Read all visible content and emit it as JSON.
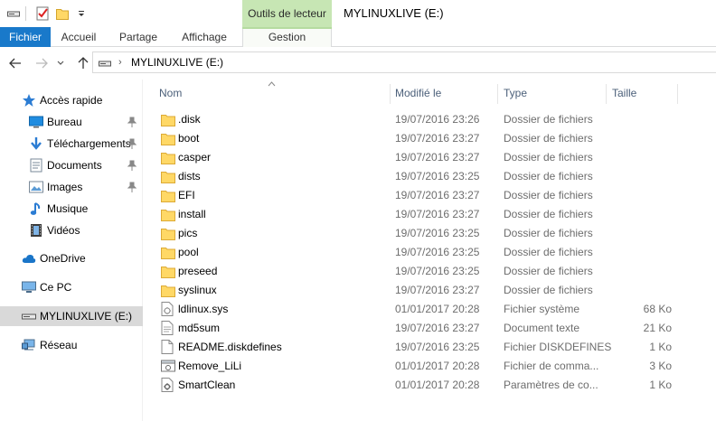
{
  "window": {
    "title": "MYLINUXLIVE (E:)"
  },
  "ribbon": {
    "context_group": "Outils de lecteur",
    "tabs": [
      {
        "label": "Fichier"
      },
      {
        "label": "Accueil"
      },
      {
        "label": "Partage"
      },
      {
        "label": "Affichage"
      },
      {
        "label": "Gestion"
      }
    ]
  },
  "address": {
    "path": "MYLINUXLIVE (E:)",
    "separator": "›"
  },
  "sidebar": {
    "items": [
      {
        "label": "Accès rapide",
        "icon": "star-icon"
      },
      {
        "label": "Bureau",
        "icon": "desktop-icon",
        "pinned": true
      },
      {
        "label": "Téléchargements",
        "icon": "download-icon",
        "pinned": true
      },
      {
        "label": "Documents",
        "icon": "documents-icon",
        "pinned": true
      },
      {
        "label": "Images",
        "icon": "images-icon",
        "pinned": true
      },
      {
        "label": "Musique",
        "icon": "music-icon"
      },
      {
        "label": "Vidéos",
        "icon": "videos-icon"
      },
      {
        "label": "OneDrive",
        "icon": "cloud-icon"
      },
      {
        "label": "Ce PC",
        "icon": "computer-icon"
      },
      {
        "label": "MYLINUXLIVE (E:)",
        "icon": "drive-icon",
        "selected": true
      },
      {
        "label": "Réseau",
        "icon": "network-icon"
      }
    ]
  },
  "columns": {
    "name": "Nom",
    "modified": "Modifié le",
    "type": "Type",
    "size": "Taille"
  },
  "files": [
    {
      "name": ".disk",
      "modified": "19/07/2016 23:26",
      "type": "Dossier de fichiers",
      "size": "",
      "icon": "folder-icon"
    },
    {
      "name": "boot",
      "modified": "19/07/2016 23:27",
      "type": "Dossier de fichiers",
      "size": "",
      "icon": "folder-icon"
    },
    {
      "name": "casper",
      "modified": "19/07/2016 23:27",
      "type": "Dossier de fichiers",
      "size": "",
      "icon": "folder-icon"
    },
    {
      "name": "dists",
      "modified": "19/07/2016 23:25",
      "type": "Dossier de fichiers",
      "size": "",
      "icon": "folder-icon"
    },
    {
      "name": "EFI",
      "modified": "19/07/2016 23:27",
      "type": "Dossier de fichiers",
      "size": "",
      "icon": "folder-icon"
    },
    {
      "name": "install",
      "modified": "19/07/2016 23:27",
      "type": "Dossier de fichiers",
      "size": "",
      "icon": "folder-icon"
    },
    {
      "name": "pics",
      "modified": "19/07/2016 23:25",
      "type": "Dossier de fichiers",
      "size": "",
      "icon": "folder-icon"
    },
    {
      "name": "pool",
      "modified": "19/07/2016 23:25",
      "type": "Dossier de fichiers",
      "size": "",
      "icon": "folder-icon"
    },
    {
      "name": "preseed",
      "modified": "19/07/2016 23:25",
      "type": "Dossier de fichiers",
      "size": "",
      "icon": "folder-icon"
    },
    {
      "name": "syslinux",
      "modified": "19/07/2016 23:27",
      "type": "Dossier de fichiers",
      "size": "",
      "icon": "folder-icon"
    },
    {
      "name": "ldlinux.sys",
      "modified": "01/01/2017 20:28",
      "type": "Fichier système",
      "size": "68 Ko",
      "icon": "system-file-icon"
    },
    {
      "name": "md5sum",
      "modified": "19/07/2016 23:27",
      "type": "Document texte",
      "size": "21 Ko",
      "icon": "text-file-icon"
    },
    {
      "name": "README.diskdefines",
      "modified": "19/07/2016 23:25",
      "type": "Fichier DISKDEFINES",
      "size": "1 Ko",
      "icon": "file-icon"
    },
    {
      "name": "Remove_LiLi",
      "modified": "01/01/2017 20:28",
      "type": "Fichier de comma...",
      "size": "3 Ko",
      "icon": "batch-file-icon"
    },
    {
      "name": "SmartClean",
      "modified": "01/01/2017 20:28",
      "type": "Paramètres de co...",
      "size": "1 Ko",
      "icon": "config-file-icon"
    }
  ]
}
